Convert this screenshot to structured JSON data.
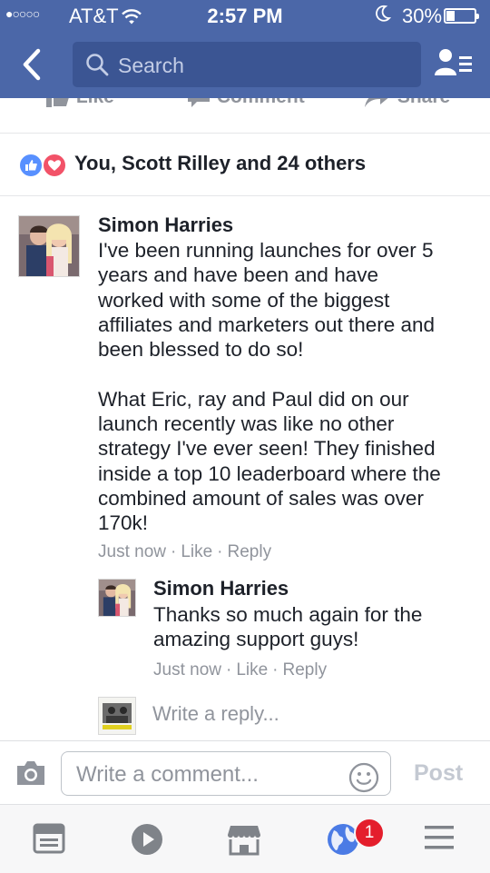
{
  "status_bar": {
    "signal": "●○○○○",
    "carrier": "AT&T",
    "time": "2:57 PM",
    "battery_percent": "30%",
    "battery_level": 0.3
  },
  "header": {
    "search_placeholder": "Search"
  },
  "post_actions": {
    "like_label": "Like",
    "comment_label": "Comment",
    "share_label": "Share"
  },
  "reactions": {
    "summary": "You, Scott Rilley and 24 others"
  },
  "comments": [
    {
      "author": "Simon Harries",
      "text": "I've been running launches for over 5\nyears and have been and have\nworked with some of the biggest\naffiliates and marketers out there and\nbeen blessed to do so!\n\nWhat Eric, ray and Paul did on our\nlaunch recently was like no other\nstrategy I've ever seen! They finished\ninside a top 10 leaderboard where the\ncombined amount of sales was over\n170k!",
      "time": "Just now",
      "like_label": "Like",
      "reply_label": "Reply"
    }
  ],
  "replies": [
    {
      "author": "Simon Harries",
      "text": "Thanks so much again for the\namazing support guys!",
      "time": "Just now",
      "like_label": "Like",
      "reply_label": "Reply"
    }
  ],
  "reply_composer": {
    "placeholder": "Write a reply..."
  },
  "comment_composer": {
    "placeholder": "Write a comment...",
    "post_label": "Post"
  },
  "tabbar": {
    "notifications_count": "1"
  },
  "colors": {
    "header_blue": "#4b67a8",
    "link_gray": "#90949c",
    "like_blue": "#5890ff",
    "love_red": "#f25268",
    "badge_red": "#e41e2c"
  }
}
